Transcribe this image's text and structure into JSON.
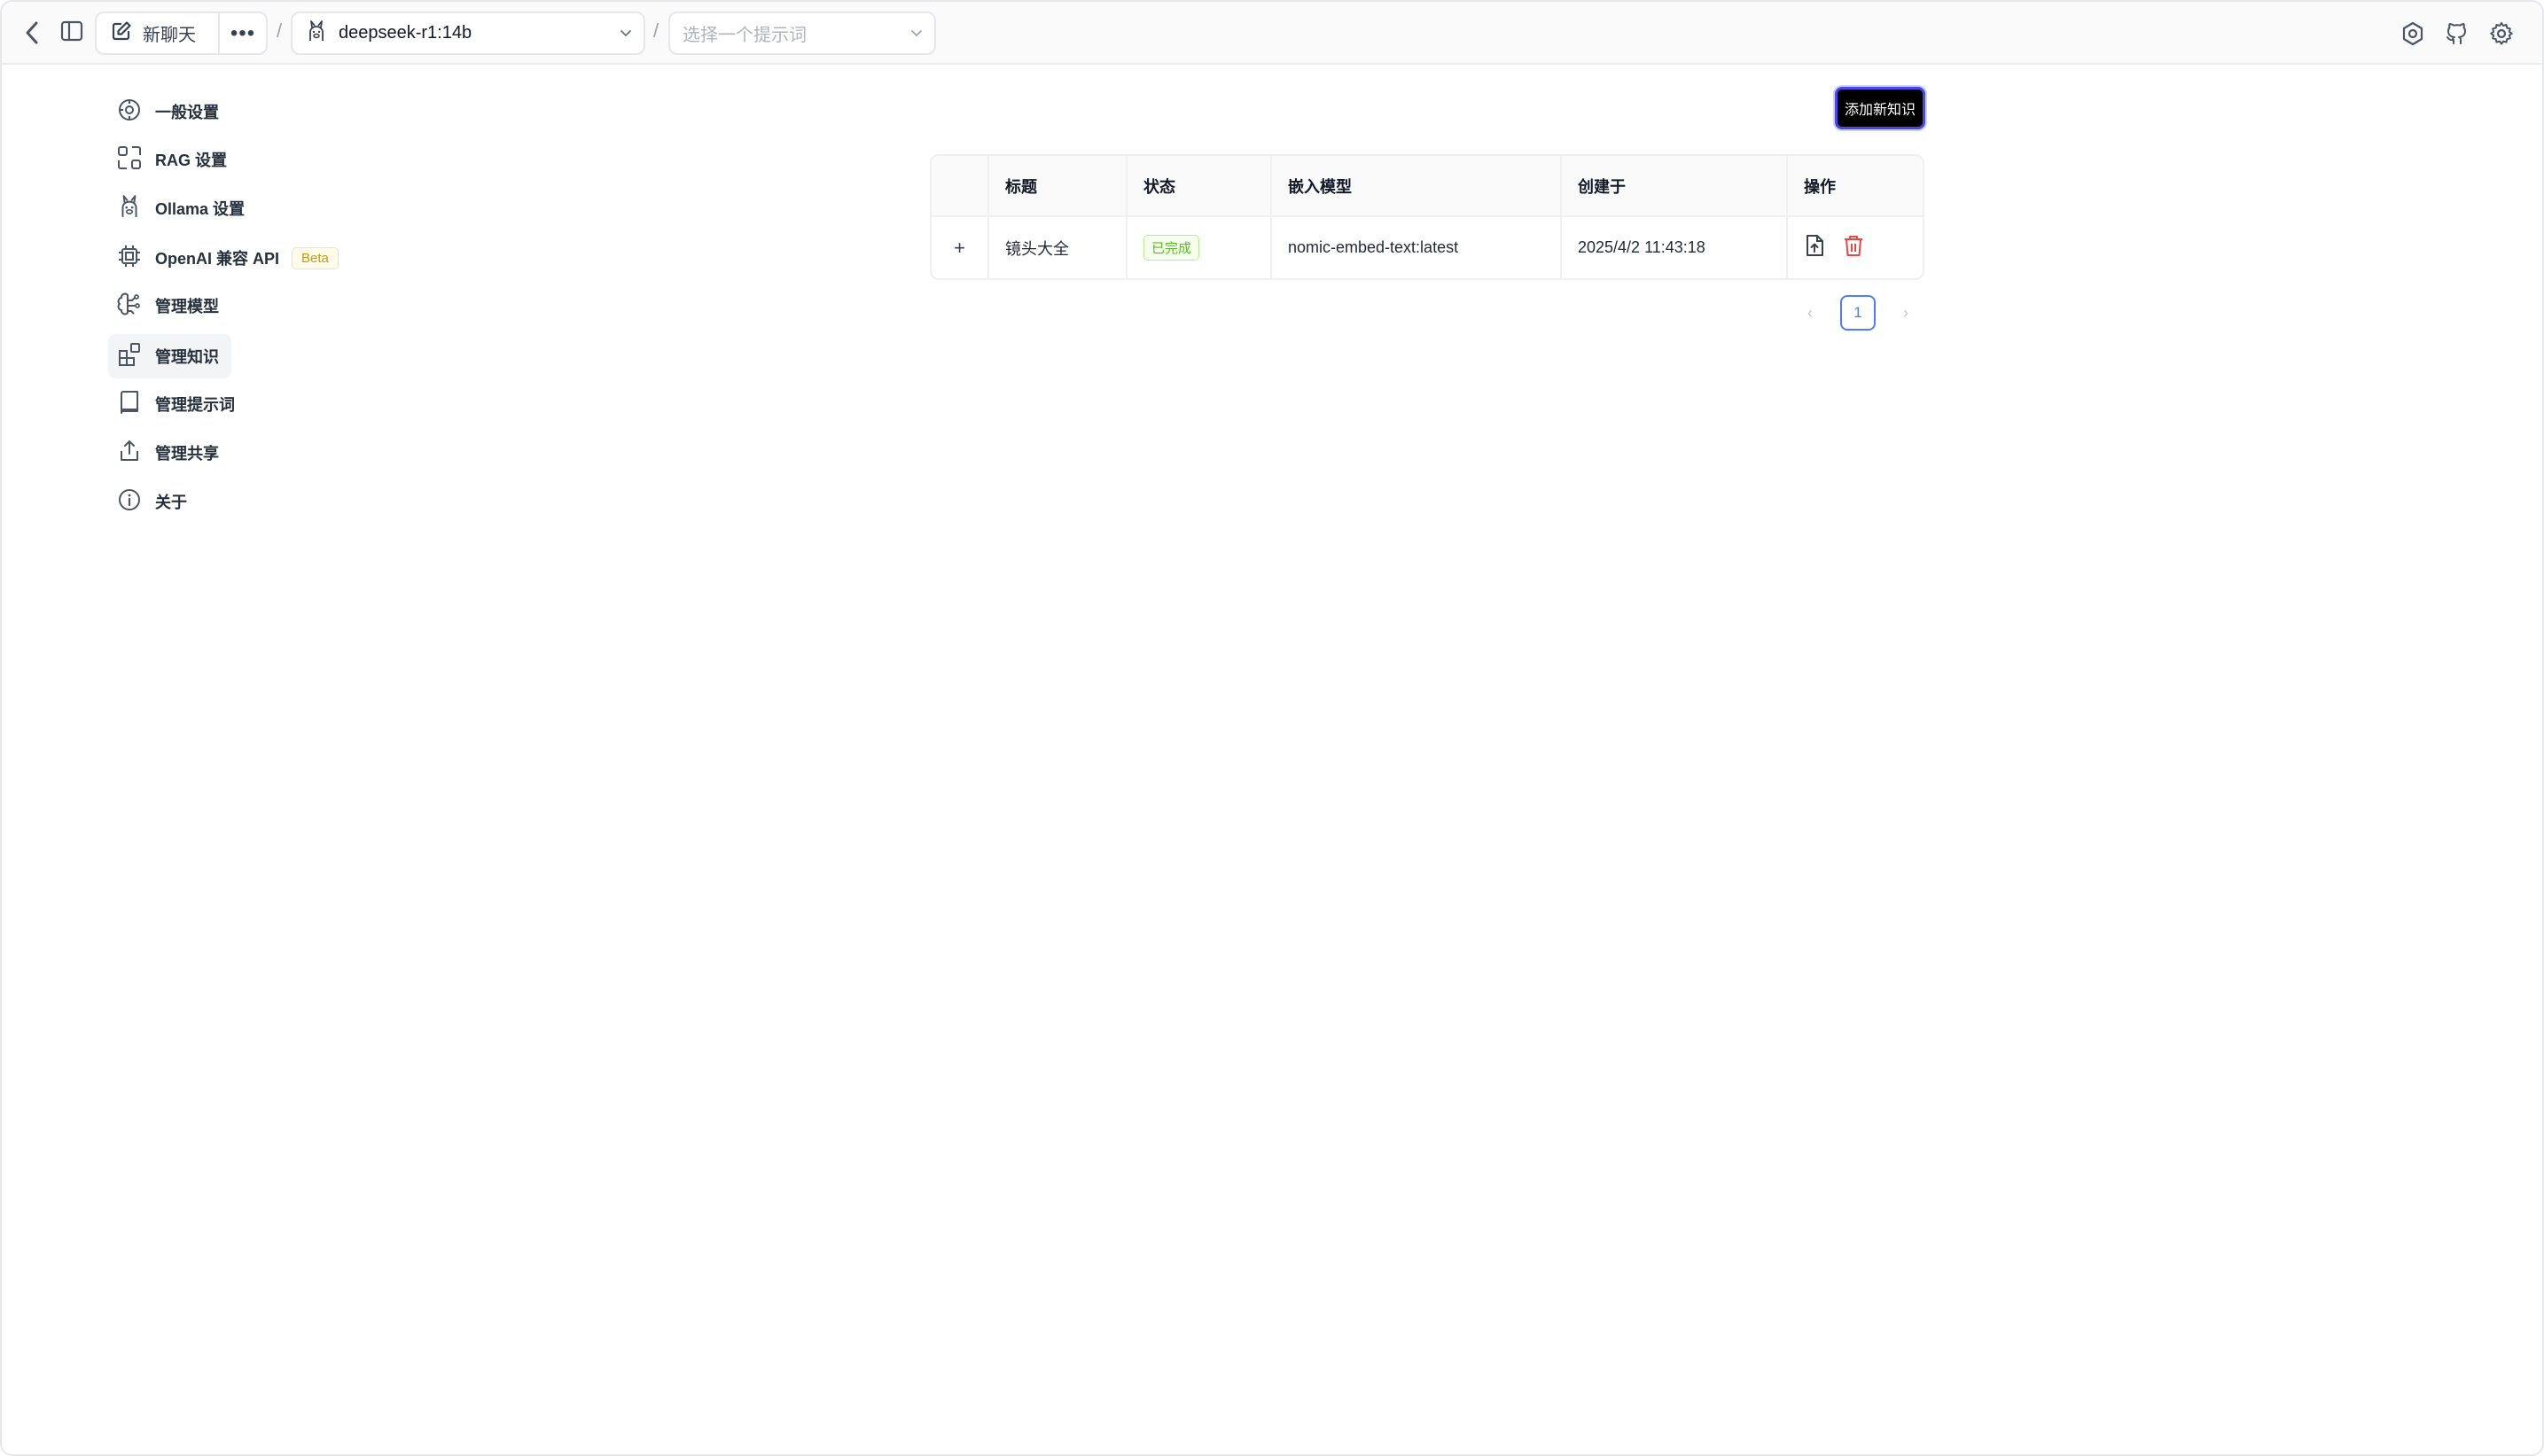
{
  "topbar": {
    "new_chat_label": "新聊天",
    "more_label": "•••",
    "separator": "/",
    "model_selected": "deepseek-r1:14b",
    "prompt_placeholder": "选择一个提示词"
  },
  "sidebar": {
    "items": [
      {
        "label": "一般设置",
        "icon": "general-settings-icon"
      },
      {
        "label": "RAG 设置",
        "icon": "rag-icon"
      },
      {
        "label": "Ollama 设置",
        "icon": "ollama-icon"
      },
      {
        "label": "OpenAI 兼容 API",
        "icon": "chip-icon",
        "badge": "Beta"
      },
      {
        "label": "管理模型",
        "icon": "brain-icon"
      },
      {
        "label": "管理知识",
        "icon": "blocks-icon",
        "active": true
      },
      {
        "label": "管理提示词",
        "icon": "book-icon"
      },
      {
        "label": "管理共享",
        "icon": "share-icon"
      },
      {
        "label": "关于",
        "icon": "info-icon"
      }
    ]
  },
  "main": {
    "add_button": "添加新知识",
    "table": {
      "headers": [
        "标题",
        "状态",
        "嵌入模型",
        "创建于",
        "操作"
      ],
      "rows": [
        {
          "expand": "+",
          "title": "镜头大全",
          "status": "已完成",
          "embedding_model": "nomic-embed-text:latest",
          "created_at": "2025/4/2 11:43:18"
        }
      ]
    },
    "pagination": {
      "prev": "‹",
      "current": "1",
      "next": "›"
    }
  },
  "colors": {
    "primary_button": "#000000",
    "status_success": "#52c41a",
    "delete": "#ef4444",
    "pager_accent": "#4f7cf7",
    "badge": "#c49a1a"
  }
}
